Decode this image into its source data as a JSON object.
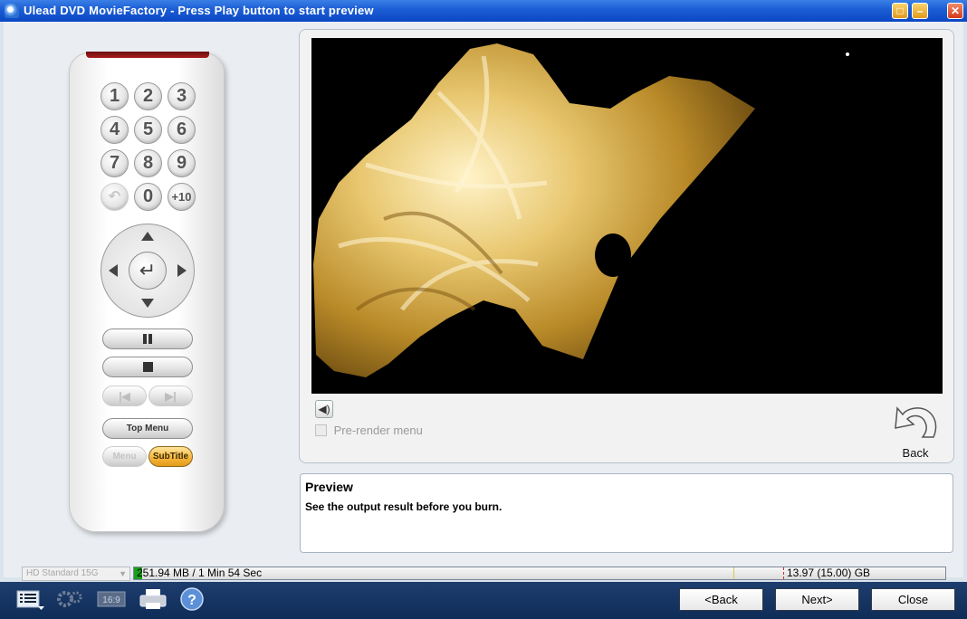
{
  "window": {
    "title": "Ulead DVD MovieFactory - Press Play button to start preview",
    "controls": {
      "restore": "□",
      "minimize": "–",
      "close": "✕"
    }
  },
  "remote": {
    "digits": [
      "1",
      "2",
      "3",
      "4",
      "5",
      "6",
      "7",
      "8",
      "9",
      "0"
    ],
    "plus10": "+10",
    "top_menu": "Top Menu",
    "menu": "Menu",
    "subtitle": "SubTitle",
    "icons": [
      "return-icon",
      "up-arrow-icon",
      "down-arrow-icon",
      "left-arrow-icon",
      "right-arrow-icon",
      "enter-icon",
      "pause-icon",
      "stop-icon",
      "prev-chapter-icon",
      "next-chapter-icon"
    ]
  },
  "preview": {
    "prerender_label": "Pre-render menu",
    "prerender_checked": false,
    "back_label": "Back"
  },
  "info": {
    "heading": "Preview",
    "description": "See the output result before you burn."
  },
  "status": {
    "disc_type": "HD Standard 15G",
    "used": "251.94 MB / 1 Min 54 Sec",
    "capacity": "13.97 (15.00) GB",
    "used_fraction": 0.01
  },
  "nav": {
    "back": "<Back",
    "next": "Next>",
    "close": "Close"
  },
  "colors": {
    "title_bar": "#1d5fd6",
    "bottom_bar": "#0f2c58",
    "subtitle_button": "#f6b43a",
    "capacity_fill": "#1aa01a"
  }
}
